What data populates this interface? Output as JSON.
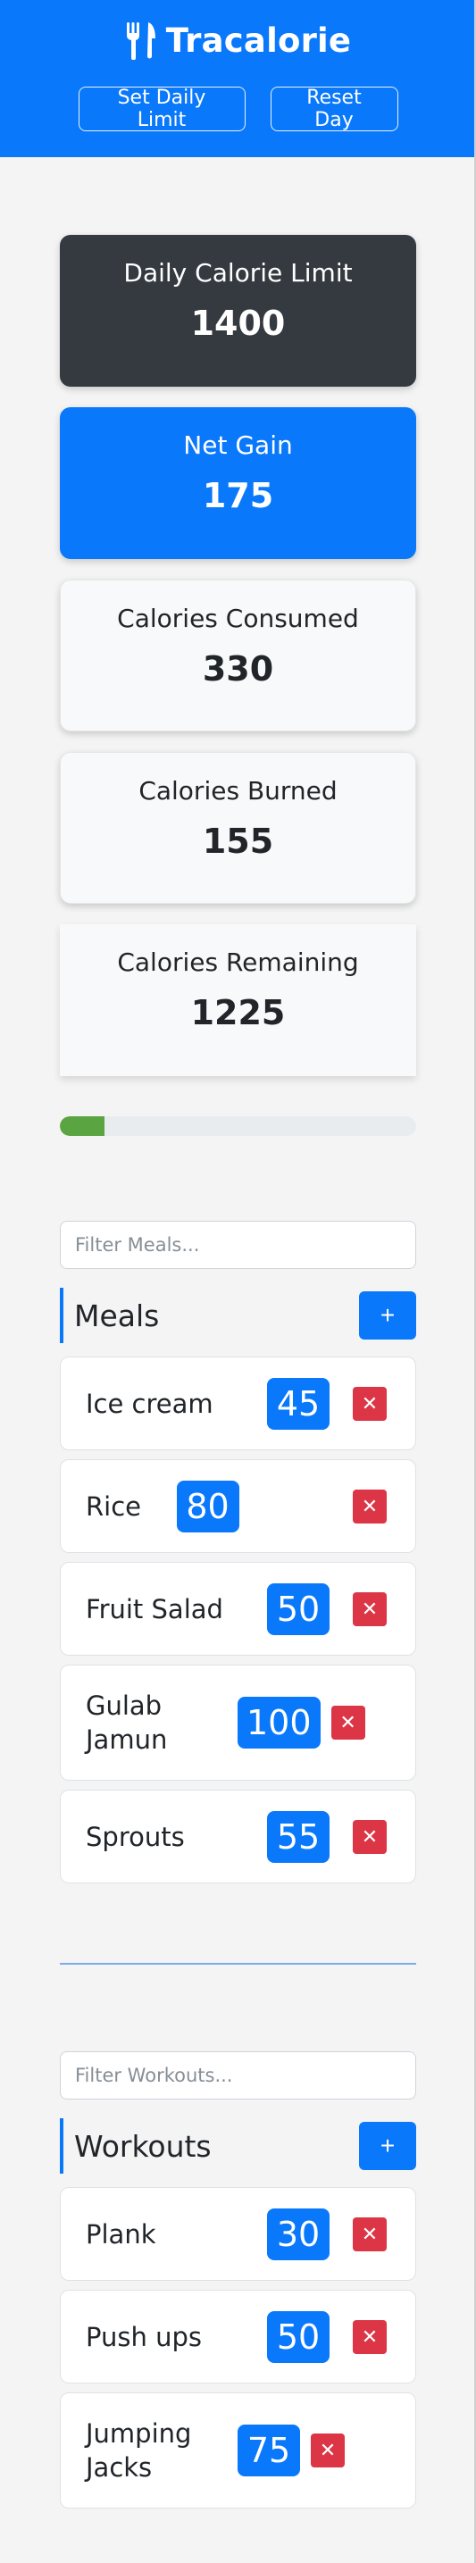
{
  "app": {
    "title": "Tracalorie",
    "logo_icon": "utensils-icon"
  },
  "header": {
    "set_limit_label": "Set Daily Limit",
    "reset_day_label": "Reset Day"
  },
  "stats": {
    "limit": {
      "label": "Daily Calorie Limit",
      "value": "1400"
    },
    "net": {
      "label": "Net Gain",
      "value": "175"
    },
    "consumed": {
      "label": "Calories Consumed",
      "value": "330"
    },
    "burned": {
      "label": "Calories Burned",
      "value": "155"
    },
    "remaining": {
      "label": "Calories Remaining",
      "value": "1225"
    }
  },
  "progress": {
    "fraction": 0.125
  },
  "meals": {
    "filter_placeholder": "Filter Meals...",
    "title": "Meals",
    "add_label": "+",
    "items": [
      {
        "name": "Ice cream",
        "calories": "45"
      },
      {
        "name": "Rice",
        "calories": "80"
      },
      {
        "name": "Fruit Salad",
        "calories": "50"
      },
      {
        "name": "Gulab Jamun",
        "calories": "100"
      },
      {
        "name": "Sprouts",
        "calories": "55"
      }
    ]
  },
  "workouts": {
    "filter_placeholder": "Filter Workouts...",
    "title": "Workouts",
    "add_label": "+",
    "items": [
      {
        "name": "Plank",
        "calories": "30"
      },
      {
        "name": "Push ups",
        "calories": "50"
      },
      {
        "name": "Jumping Jacks",
        "calories": "75"
      }
    ]
  },
  "delete_label": "✕",
  "colors": {
    "primary": "#0a78fa",
    "dark": "#343a40",
    "danger": "#dc3545",
    "success": "#5aa542"
  }
}
